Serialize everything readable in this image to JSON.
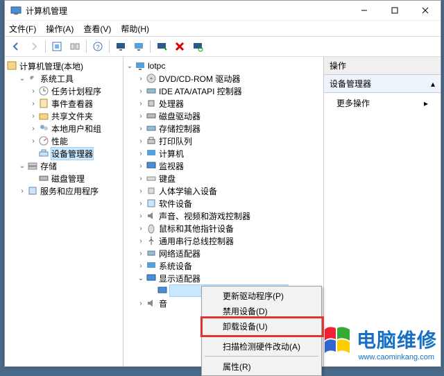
{
  "window": {
    "title": "计算机管理"
  },
  "menu": {
    "file": "文件(F)",
    "action": "操作(A)",
    "view": "查看(V)",
    "help": "帮助(H)"
  },
  "left_tree": {
    "root": "计算机管理(本地)",
    "sys_tools": "系统工具",
    "task_sched": "任务计划程序",
    "event_viewer": "事件查看器",
    "shared": "共享文件夹",
    "local_users": "本地用户和组",
    "perf": "性能",
    "devmgr": "设备管理器",
    "storage": "存储",
    "disk": "磁盘管理",
    "services": "服务和应用程序"
  },
  "mid_tree": {
    "root": "lotpc",
    "dvd": "DVD/CD-ROM 驱动器",
    "ide": "IDE ATA/ATAPI 控制器",
    "cpu": "处理器",
    "diskdrv": "磁盘驱动器",
    "storctrl": "存储控制器",
    "printq": "打印队列",
    "computer": "计算机",
    "monitor": "监视器",
    "keyboard": "键盘",
    "hid": "人体学输入设备",
    "swdev": "软件设备",
    "sound": "声音、视频和游戏控制器",
    "mouse": "鼠标和其他指针设备",
    "usb": "通用串行总线控制器",
    "netadapter": "网络适配器",
    "sysdev": "系统设备",
    "display": "显示适配器",
    "display_child": "",
    "audioio": "音"
  },
  "actions": {
    "header": "操作",
    "section": "设备管理器",
    "more": "更多操作"
  },
  "context_menu": {
    "update": "更新驱动程序(P)",
    "disable": "禁用设备(D)",
    "uninstall": "卸载设备(U)",
    "scan": "扫描检测硬件改动(A)",
    "props": "属性(R)"
  },
  "watermark": {
    "text": "电脑维修",
    "url": "www.caominkang.com"
  }
}
